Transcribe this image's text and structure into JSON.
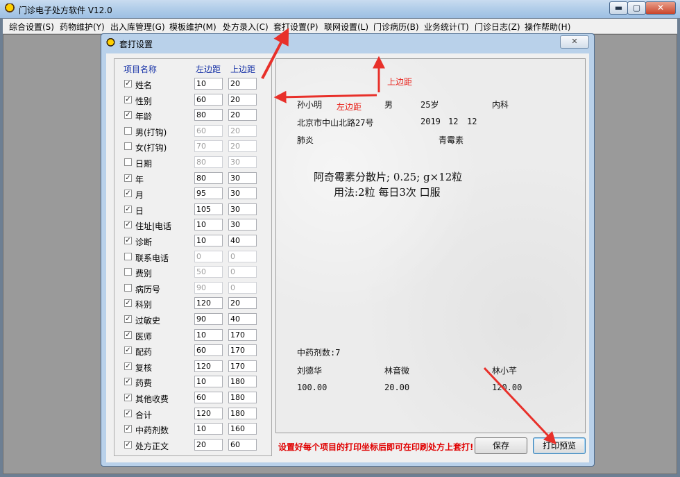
{
  "app": {
    "title": "门诊电子处方软件   V12.0",
    "window_buttons": {
      "minimize": "▬",
      "maximize": "▢",
      "close": "✕"
    }
  },
  "menu": [
    "综合设置(S)",
    "药物维护(Y)",
    "出入库管理(G)",
    "模板维护(M)",
    "处方录入(C)",
    "套打设置(P)",
    "联网设置(L)",
    "门诊病历(B)",
    "业务统计(T)",
    "门诊日志(Z)",
    "操作帮助(H)"
  ],
  "dialog": {
    "title": "套打设置",
    "close": "✕",
    "headers": {
      "name": "项目名称",
      "left": "左边距",
      "top": "上边距"
    },
    "fields": [
      {
        "name": "姓名",
        "checked": true,
        "left": "10",
        "top": "20"
      },
      {
        "name": "性别",
        "checked": true,
        "left": "60",
        "top": "20"
      },
      {
        "name": "年龄",
        "checked": true,
        "left": "80",
        "top": "20"
      },
      {
        "name": "男(打钩)",
        "checked": false,
        "left": "60",
        "top": "20"
      },
      {
        "name": "女(打钩)",
        "checked": false,
        "left": "70",
        "top": "20"
      },
      {
        "name": "日期",
        "checked": false,
        "left": "80",
        "top": "30"
      },
      {
        "name": "年",
        "checked": true,
        "left": "80",
        "top": "30"
      },
      {
        "name": "月",
        "checked": true,
        "left": "95",
        "top": "30"
      },
      {
        "name": "日",
        "checked": true,
        "left": "105",
        "top": "30"
      },
      {
        "name": "住址|电话",
        "checked": true,
        "left": "10",
        "top": "30"
      },
      {
        "name": "诊断",
        "checked": true,
        "left": "10",
        "top": "40"
      },
      {
        "name": "联系电话",
        "checked": false,
        "left": "0",
        "top": "0"
      },
      {
        "name": "费别",
        "checked": false,
        "left": "50",
        "top": "0"
      },
      {
        "name": "病历号",
        "checked": false,
        "left": "90",
        "top": "0"
      },
      {
        "name": "科别",
        "checked": true,
        "left": "120",
        "top": "20"
      },
      {
        "name": "过敏史",
        "checked": true,
        "left": "90",
        "top": "40"
      },
      {
        "name": "医师",
        "checked": true,
        "left": "10",
        "top": "170"
      },
      {
        "name": "配药",
        "checked": true,
        "left": "60",
        "top": "170"
      },
      {
        "name": "复核",
        "checked": true,
        "left": "120",
        "top": "170"
      },
      {
        "name": "药费",
        "checked": true,
        "left": "10",
        "top": "180"
      },
      {
        "name": "其他收费",
        "checked": true,
        "left": "60",
        "top": "180"
      },
      {
        "name": "合计",
        "checked": true,
        "left": "120",
        "top": "180"
      },
      {
        "name": "中药剂数",
        "checked": true,
        "left": "10",
        "top": "160"
      },
      {
        "name": "处方正文",
        "checked": true,
        "left": "20",
        "top": "60"
      }
    ],
    "preview": {
      "name": "孙小明",
      "gender": "男",
      "age": "25岁",
      "dept": "内科",
      "address": "北京市中山北路27号",
      "year": "2019",
      "month": "12",
      "day": "12",
      "diagnosis": "肺炎",
      "allergy": "青霉素",
      "rx_line1": "阿奇霉素分散片; 0.25; g×12粒",
      "rx_line2": "用法:2粒 每日3次 口服",
      "herbal_count": "中药剂数:7",
      "doctor": "刘德华",
      "dispenser": "林音微",
      "checker": "林小芊",
      "drug_fee": "100.00",
      "other_fee": "20.00",
      "total": "120.00"
    },
    "annotations": {
      "top_margin": "上边距",
      "left_margin": "左边距"
    },
    "hint": "设置好每个项目的打印坐标后即可在印刷处方上套打!",
    "buttons": {
      "save": "保存",
      "print_preview": "打印预览"
    }
  },
  "colors": {
    "annotation": "#e8221b",
    "hint": "#e00000",
    "header": "#1a35a8"
  }
}
